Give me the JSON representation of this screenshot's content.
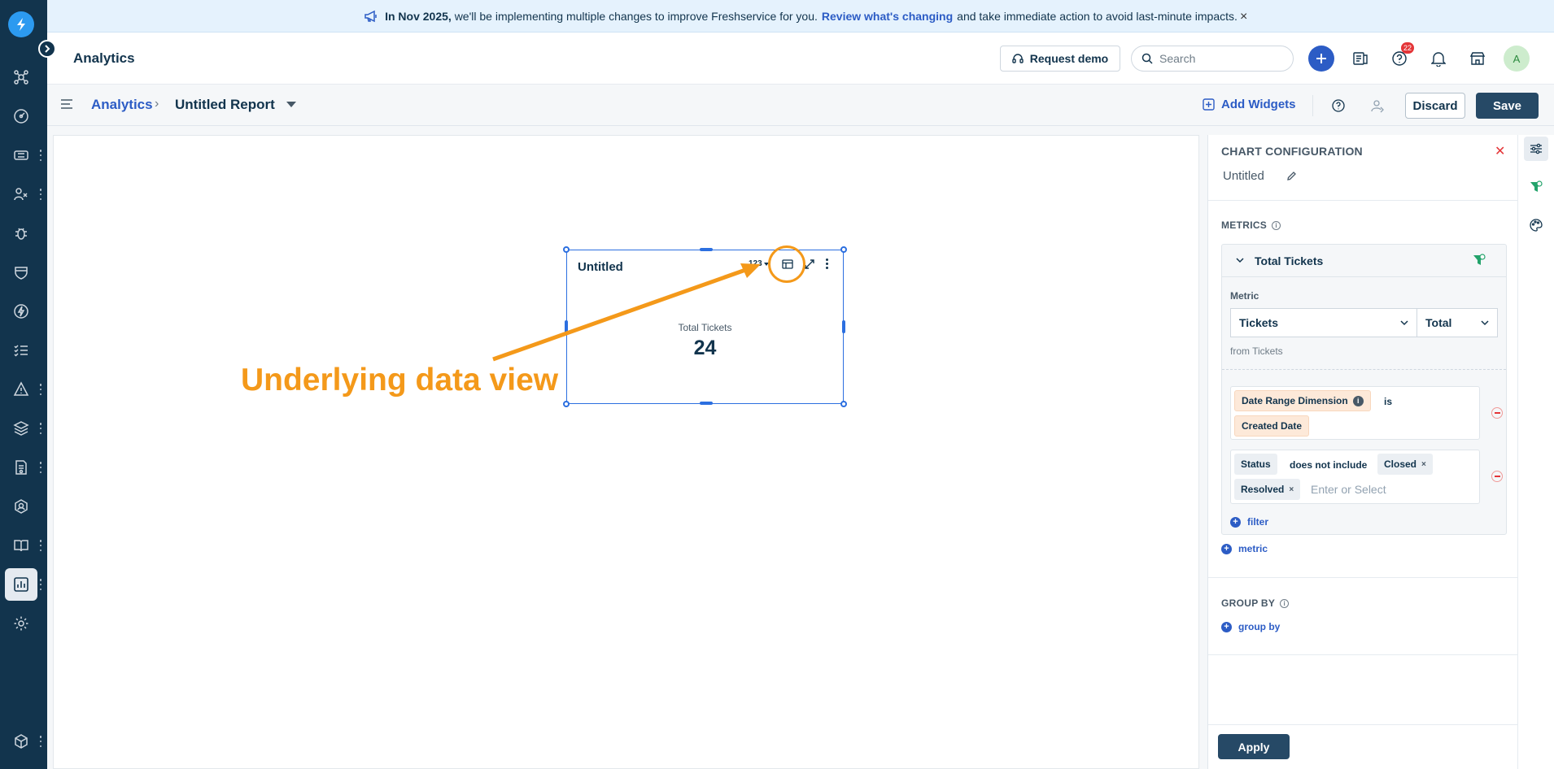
{
  "banner": {
    "bold": "In Nov 2025,",
    "text1": "we'll be implementing multiple changes to improve Freshservice for you.",
    "link": "Review what's changing",
    "text2": "and take immediate action to avoid last-minute impacts.",
    "close": "×"
  },
  "header": {
    "title": "Analytics",
    "demo_label": "Request demo",
    "search_placeholder": "Search",
    "help_badge": "22",
    "avatar": "A"
  },
  "toolbar": {
    "breadcrumb_root": "Analytics",
    "breadcrumb_sep": "›",
    "report_title": "Untitled Report",
    "add_widgets": "Add Widgets",
    "discard": "Discard",
    "save": "Save"
  },
  "widget": {
    "title": "Untitled",
    "viz_code": "123",
    "metric_label": "Total Tickets",
    "metric_value": "24"
  },
  "annotation": {
    "text": "Underlying data view",
    "color": "#f4991a"
  },
  "panel": {
    "title": "CHART CONFIGURATION",
    "close": "✕",
    "name": "Untitled",
    "metrics_label": "METRICS",
    "metric_card": {
      "title": "Total Tickets",
      "metric_label": "Metric",
      "metric_select": "Tickets",
      "agg_select": "Total",
      "from": "from Tickets",
      "filter1": {
        "field": "Date Range Dimension",
        "op": "is",
        "value": "Created Date"
      },
      "filter2": {
        "field": "Status",
        "op": "does not include",
        "values": [
          "Closed",
          "Resolved"
        ],
        "placeholder": "Enter or Select"
      },
      "add_filter": "filter"
    },
    "add_metric": "metric",
    "group_by_label": "GROUP BY",
    "add_group_by": "group by",
    "apply": "Apply"
  },
  "colors": {
    "nav_bg": "#12344d",
    "primary": "#2c5cc5",
    "save_bg": "#264966",
    "accent_orange": "#f4991a",
    "danger": "#e43538"
  }
}
